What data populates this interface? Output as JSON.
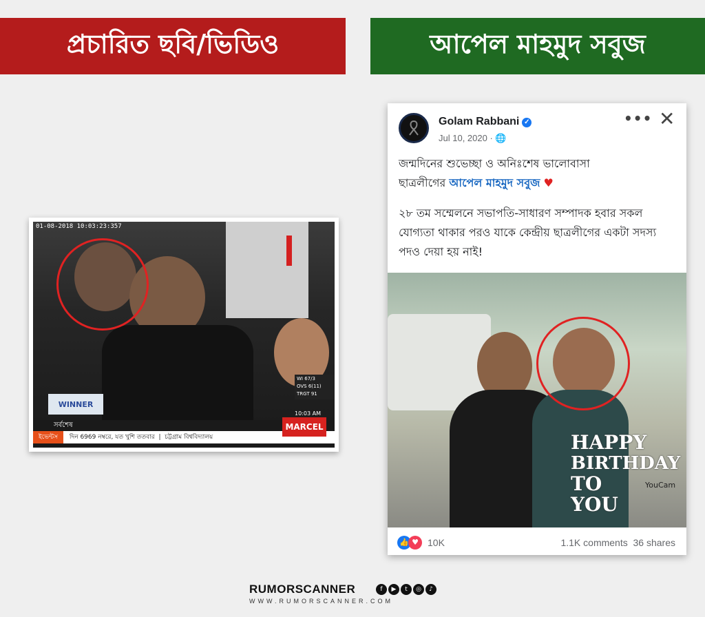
{
  "banners": {
    "left": "প্রচারিত ছবি/ভিডিও",
    "right": "আপেল মাহমুদ সবুজ"
  },
  "colors": {
    "left_banner": "#b41c1c",
    "right_banner": "#1f6a22",
    "highlight_circle": "#e02222",
    "fb_blue": "#1877f2"
  },
  "video": {
    "timestamp": "01-08-2018 10:03:23:357",
    "winner_label": "WINNER",
    "ticker_label": "সর্বশেষ",
    "ticker_tag": "ইভেন্টস",
    "ticker_text": "দিন 6969 নম্বরে, যত খুশি ততবার",
    "ticker_text_2": "চট্টগ্রাম বিশ্ববিদ্যালয়",
    "scoreboard": [
      "WI 67/3",
      "OVS 6(11)",
      "TRGT 91"
    ],
    "clock": "10:03 AM",
    "sponsor": "MARCEL"
  },
  "post": {
    "author": "Golam Rabbani",
    "date": "Jul 10, 2020 · ",
    "globe_icon": "🌐",
    "more_icon": "•••",
    "close_icon": "✕",
    "line1": "জন্মদিনের শুভেচ্ছা ও অনিঃশেষ ভালোবাসা",
    "line2_prefix": "ছাত্রলীগের ",
    "line2_link": "আপেল মাহমুদ সবুজ",
    "heart": "♥",
    "line3": "২৮ তম সম্মেলনে সভাপতি-সাধারণ সম্পাদক হবার সকল যোগ্যতা থাকার পরও যাকে কেন্দ্রীয় ছাত্রলীগের একটা সদস্য পদও দেয়া হয় নাই!",
    "photo_overlay": [
      "HAPPY",
      "BIRTHDAY",
      "TO",
      "YOU"
    ],
    "photo_watermark": "YouCam",
    "reactions": "10K",
    "comments": "1.1K comments",
    "shares": "36 shares"
  },
  "brand": {
    "name": "RUMORSCANNER",
    "url": "WWW.RUMORSCANNER.COM"
  }
}
